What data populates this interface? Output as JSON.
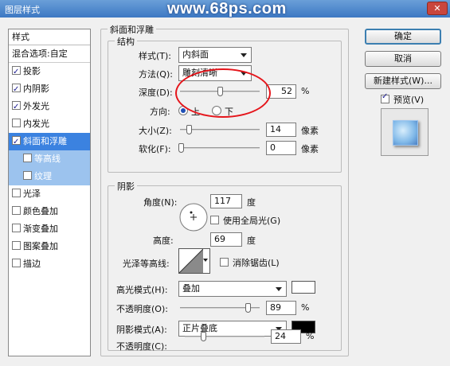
{
  "window": {
    "title": "图层样式",
    "watermark": "www.68ps.com",
    "close_glyph": "✕"
  },
  "style_list": {
    "header": "样式",
    "blend_options": "混合选项:自定",
    "items": [
      {
        "label": "投影",
        "checked": true
      },
      {
        "label": "内阴影",
        "checked": true
      },
      {
        "label": "外发光",
        "checked": true
      },
      {
        "label": "内发光",
        "checked": false
      },
      {
        "label": "斜面和浮雕",
        "checked": true,
        "selected": true
      },
      {
        "label": "等高线",
        "checked": false,
        "sub": true
      },
      {
        "label": "纹理",
        "checked": false,
        "sub": true
      },
      {
        "label": "光泽",
        "checked": false
      },
      {
        "label": "颜色叠加",
        "checked": false
      },
      {
        "label": "渐变叠加",
        "checked": false
      },
      {
        "label": "图案叠加",
        "checked": false
      },
      {
        "label": "描边",
        "checked": false
      }
    ]
  },
  "bevel": {
    "title": "斜面和浮雕",
    "structure": {
      "title": "结构",
      "style_label": "样式(T):",
      "style_value": "内斜面",
      "technique_label": "方法(Q):",
      "technique_value": "雕刻清晰",
      "depth_label": "深度(D):",
      "depth_value": "52",
      "depth_unit": "%",
      "depth_pct": 52,
      "direction_label": "方向:",
      "dir_up": "上",
      "dir_down": "下",
      "size_label": "大小(Z):",
      "size_value": "14",
      "size_unit": "像素",
      "soften_label": "软化(F):",
      "soften_value": "0",
      "soften_unit": "像素"
    },
    "shading": {
      "title": "阴影",
      "angle_label": "角度(N):",
      "angle_value": "117",
      "angle_unit": "度",
      "global_light": "使用全局光(G)",
      "altitude_label": "高度:",
      "altitude_value": "69",
      "altitude_unit": "度",
      "gloss_label": "光泽等高线:",
      "antialias": "消除锯齿(L)",
      "highlight_label": "高光模式(H):",
      "highlight_mode": "叠加",
      "highlight_color": "#ffffff",
      "hl_opacity_label": "不透明度(O):",
      "hl_opacity_value": "89",
      "hl_opacity_unit": "%",
      "shadow_label": "阴影模式(A):",
      "shadow_mode": "正片叠底",
      "shadow_color": "#000000",
      "sh_opacity_label": "不透明度(C):",
      "sh_opacity_value": "24",
      "sh_opacity_unit": "%"
    }
  },
  "buttons": {
    "ok": "确定",
    "cancel": "取消",
    "new_style": "新建样式(W)...",
    "preview": "预览(V)",
    "preview_checked": true
  },
  "colors": {
    "selected": "#3b82e0",
    "sub_selected": "#9cc3ee",
    "annotation": "#e5151b"
  }
}
